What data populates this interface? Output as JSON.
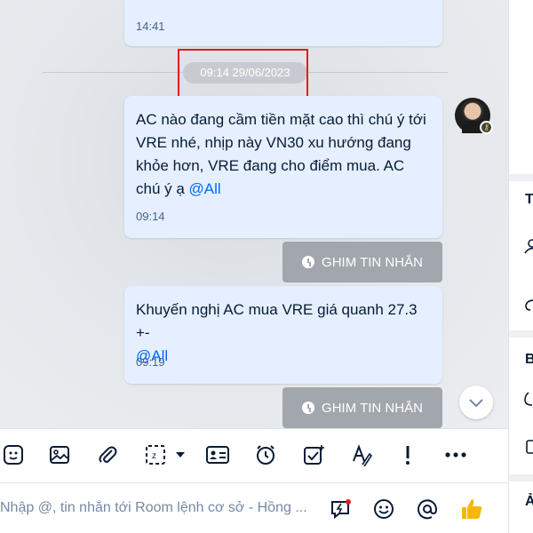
{
  "messages": [
    {
      "time": "14:41"
    },
    {
      "text": "AC nào đang cầm tiền mặt cao thì chú ý tới VRE nhé, nhịp này VN30 xu hướng đang khỏe hơn, VRE đang cho điểm mua. AC chú ý ạ",
      "mention": "@All",
      "time": "09:14"
    },
    {
      "text": "Khuyến nghị AC mua VRE giá quanh 27.3 +-",
      "mention": "@All",
      "time": "09:19"
    }
  ],
  "date_separator": "09:14 29/06/2023",
  "pin_button_label": "GHIM TIN NHẮN",
  "toolbar": {
    "icons": [
      "sticker-icon",
      "image-icon",
      "attachment-icon",
      "screenshot-icon",
      "contact-card-icon",
      "reminder-icon",
      "task-icon",
      "text-format-icon",
      "urgent-icon",
      "more-icon"
    ]
  },
  "composer": {
    "placeholder": "Nhập @, tin nhắn tới Room lệnh cơ sở - Hồng ..."
  },
  "right_panel": {
    "letters": [
      "T",
      "B",
      "Ả"
    ]
  },
  "colors": {
    "bubble": "#e5efff",
    "mention": "#0068ff",
    "pin_button": "#a2a7ae",
    "highlight": "#e11b22",
    "like": "#f5b800"
  }
}
